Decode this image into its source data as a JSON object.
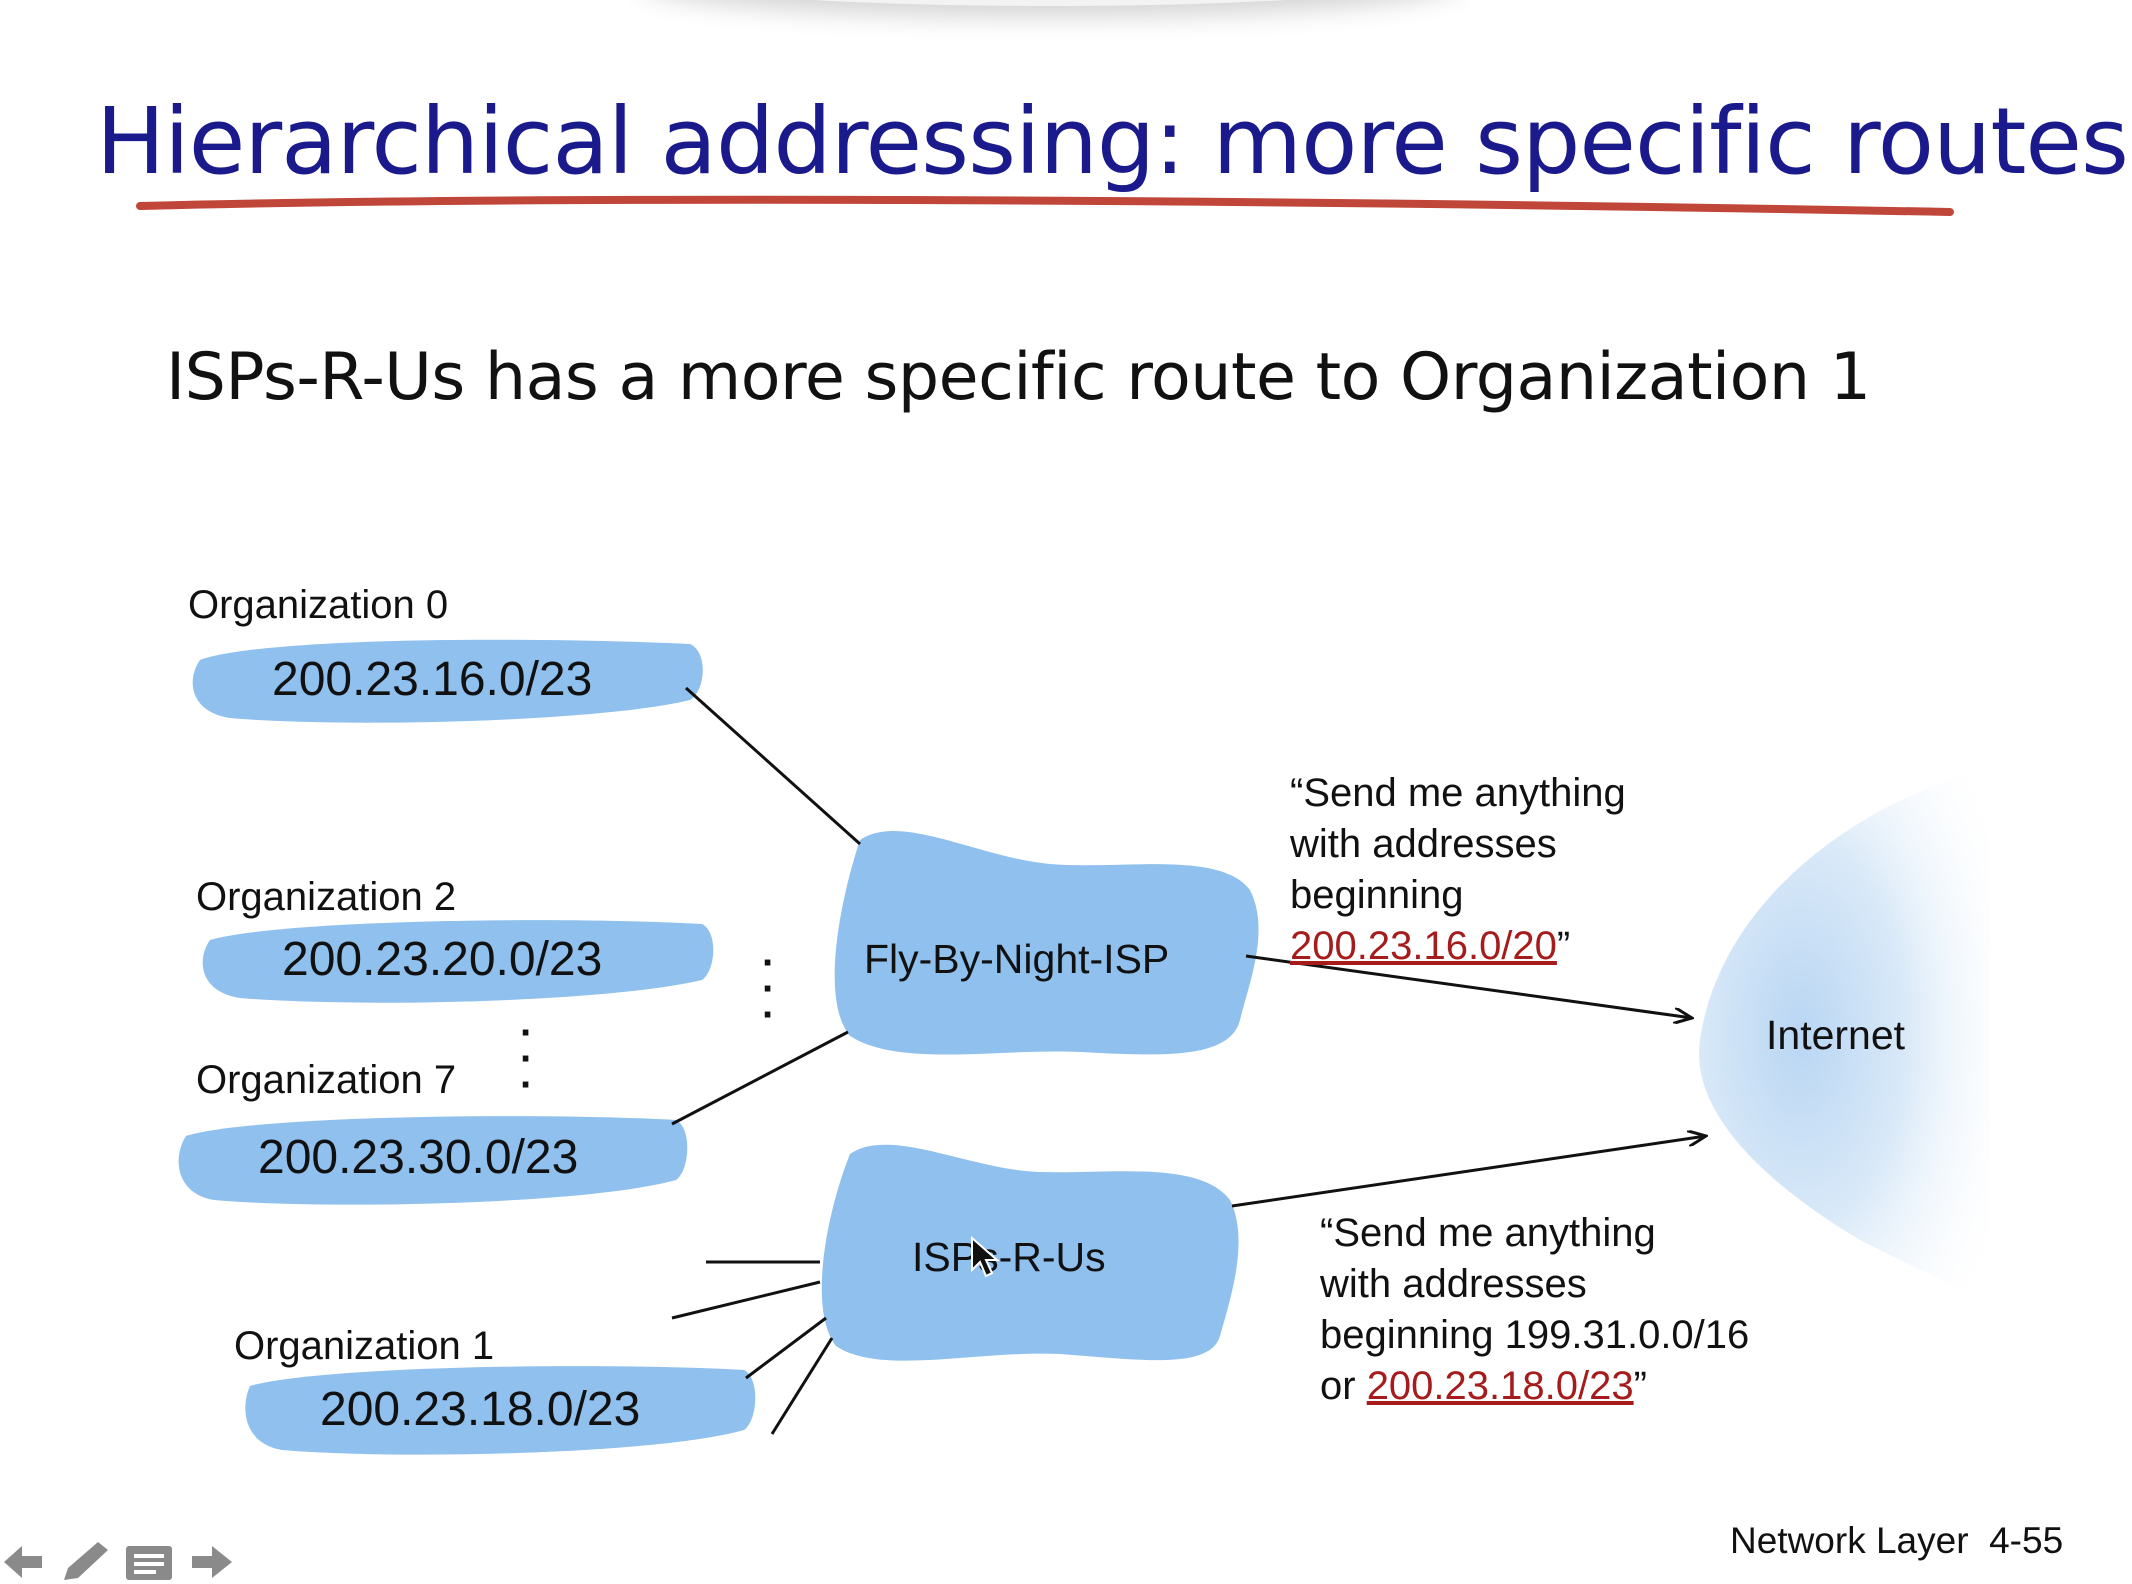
{
  "slide": {
    "title": "Hierarchical addressing: more specific routes",
    "subtitle": "ISPs-R-Us has a more specific route to Organization 1",
    "footer": "Network Layer  4-55"
  },
  "organizations": [
    {
      "label": "Organization 0",
      "prefix": "200.23.16.0/23"
    },
    {
      "label": "Organization 2",
      "prefix": "200.23.20.0/23"
    },
    {
      "label": "Organization 7",
      "prefix": "200.23.30.0/23"
    },
    {
      "label": "Organization 1",
      "prefix": "200.23.18.0/23"
    }
  ],
  "isps": {
    "fly_by_night": "Fly-By-Night-ISP",
    "isps_r_us": "ISPs-R-Us"
  },
  "internet": "Internet",
  "announcements": {
    "fly_by_night": {
      "line1": "“Send me anything",
      "line2": "with addresses",
      "line3": "beginning",
      "link": "200.23.16.0/20",
      "close": "”"
    },
    "isps_r_us": {
      "line1": "“Send me anything",
      "line2": "with addresses",
      "line3": "beginning 199.31.0.0/16",
      "or": "or ",
      "link": "200.23.18.0/23",
      "close": "”"
    }
  },
  "colors": {
    "title": "#1a1a8c",
    "underline": "#c0463a",
    "cloud": "#8fc0ee",
    "link": "#a61c1c"
  },
  "icons": [
    "arrow-left-icon",
    "pen-icon",
    "menu-icon",
    "arrow-right-icon"
  ]
}
